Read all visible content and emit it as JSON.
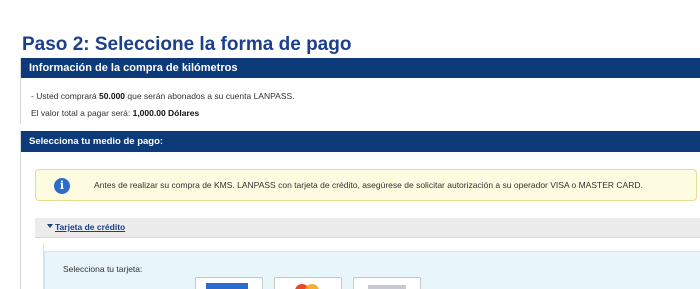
{
  "page": {
    "title": "Paso 2: Seleccione la forma de pago"
  },
  "summary": {
    "header": "Información de la compra de kilómetros",
    "line1_prefix": "- Usted comprará ",
    "line1_amount": "50.000",
    "line1_suffix": " que serán abonados a su cuenta LANPASS.",
    "line2_prefix": "El valor total a pagar será: ",
    "line2_amount": "1,000.00 Dólares"
  },
  "payment": {
    "header": "Selecciona tu medio de pago:",
    "notice": "Antes de realizar su compra de KMS. LANPASS con tarjeta de crédito, asegúrese de solicitar autorización a su operador VISA o MASTER CARD.",
    "accordion_label": "Tarjeta de crédito",
    "card_label": "Selecciona tu tarjeta:",
    "cards": [
      {
        "name": "amex-card-option",
        "icon": "amex-logo-icon",
        "color": "#2a6bd0"
      },
      {
        "name": "mastercard-card-option",
        "icon": "mastercard-logo-icon",
        "color": "#e8472a"
      },
      {
        "name": "visa-card-option",
        "icon": "visa-logo-icon",
        "color": "#c9c9d6"
      }
    ]
  },
  "colors": {
    "header_bg": "#0d3b7a",
    "title": "#1b3f8b",
    "notice_bg": "#fdfbe0",
    "card_panel_bg": "#e8f5fb"
  }
}
